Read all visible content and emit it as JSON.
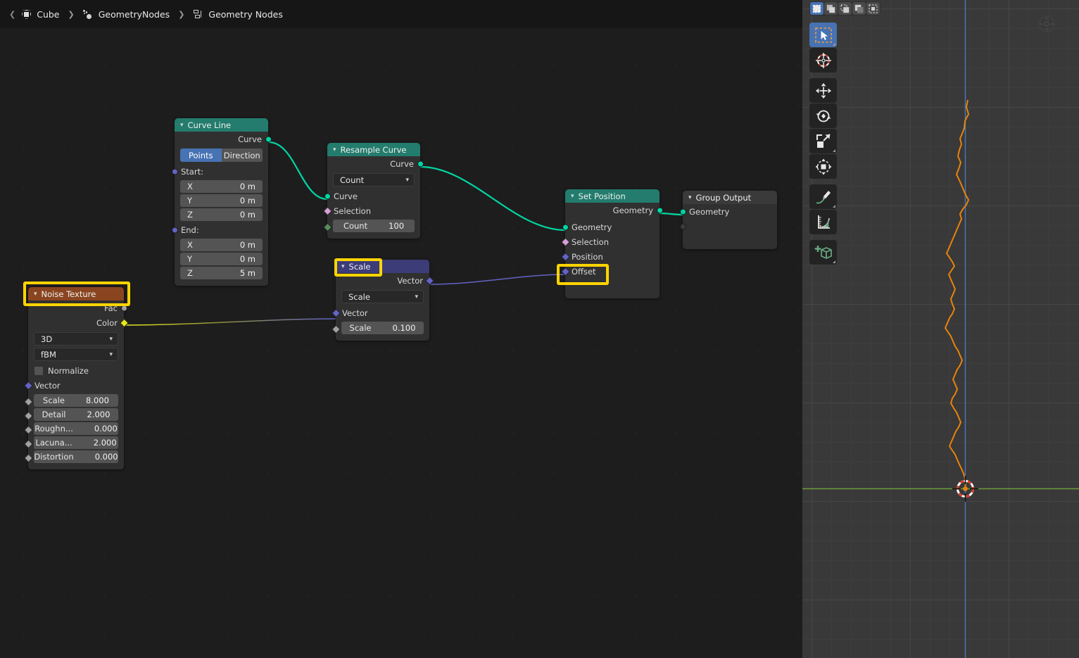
{
  "breadcrumb": {
    "back_arrow": "❮",
    "items": [
      {
        "label": "Cube",
        "icon": "object-icon"
      },
      {
        "label": "GeometryNodes",
        "icon": "modifier-icon"
      },
      {
        "label": "Geometry Nodes",
        "icon": "node-tree-icon"
      }
    ],
    "separator": "❯"
  },
  "nodes": {
    "curve_line": {
      "title": "Curve Line",
      "header_color": "#237c6d",
      "outputs": [
        {
          "label": "Curve",
          "type": "geometry"
        }
      ],
      "mode_toggle": {
        "option_a": "Points",
        "option_b": "Direction",
        "selected": "Points"
      },
      "start_label": "Start:",
      "start": [
        {
          "axis": "X",
          "value": "0 m"
        },
        {
          "axis": "Y",
          "value": "0 m"
        },
        {
          "axis": "Z",
          "value": "0 m"
        }
      ],
      "end_label": "End:",
      "end": [
        {
          "axis": "X",
          "value": "0 m"
        },
        {
          "axis": "Y",
          "value": "0 m"
        },
        {
          "axis": "Z",
          "value": "5 m"
        }
      ]
    },
    "resample_curve": {
      "title": "Resample Curve",
      "header_color": "#237c6d",
      "outputs": [
        {
          "label": "Curve",
          "type": "geometry"
        }
      ],
      "mode": "Count",
      "inputs": [
        {
          "label": "Curve",
          "type": "geometry"
        },
        {
          "label": "Selection",
          "type": "boolean"
        }
      ],
      "count": {
        "label": "Count",
        "value": "100"
      }
    },
    "set_position": {
      "title": "Set Position",
      "header_color": "#237c6d",
      "outputs": [
        {
          "label": "Geometry",
          "type": "geometry"
        }
      ],
      "inputs": [
        {
          "label": "Geometry",
          "type": "geometry"
        },
        {
          "label": "Selection",
          "type": "boolean"
        },
        {
          "label": "Position",
          "type": "vector"
        },
        {
          "label": "Offset",
          "type": "vector",
          "highlighted": true
        }
      ]
    },
    "group_output": {
      "title": "Group Output",
      "header_color": "#3a3a3a",
      "inputs": [
        {
          "label": "Geometry",
          "type": "geometry"
        }
      ]
    },
    "scale": {
      "title": "Scale",
      "header_color": "#3c3c78",
      "highlighted": true,
      "outputs": [
        {
          "label": "Vector",
          "type": "vector"
        }
      ],
      "operation": "Scale",
      "inputs": [
        {
          "label": "Vector",
          "type": "vector"
        }
      ],
      "scale_field": {
        "label": "Scale",
        "value": "0.100"
      }
    },
    "noise_texture": {
      "title": "Noise Texture",
      "header_color": "#8a4520",
      "highlighted": true,
      "outputs": [
        {
          "label": "Fac",
          "type": "float"
        },
        {
          "label": "Color",
          "type": "color"
        }
      ],
      "dimension": "3D",
      "noise_type": "fBM",
      "normalize": {
        "label": "Normalize",
        "checked": false
      },
      "vector_input": "Vector",
      "fields": [
        {
          "label": "Scale",
          "value": "8.000"
        },
        {
          "label": "Detail",
          "value": "2.000"
        },
        {
          "label": "Roughn...",
          "value": "0.000"
        },
        {
          "label": "Lacuna...",
          "value": "2.000"
        },
        {
          "label": "Distortion",
          "value": "0.000"
        }
      ]
    }
  },
  "viewport": {
    "select_modes": [
      {
        "name": "set-selection",
        "active": true
      },
      {
        "name": "extend-selection",
        "active": false
      },
      {
        "name": "subtract-selection",
        "active": false
      },
      {
        "name": "invert-selection",
        "active": false
      },
      {
        "name": "intersect-selection",
        "active": false
      }
    ],
    "tools": [
      {
        "name": "tweak-tool",
        "icon": "cursor-arrow-icon",
        "active": true
      },
      {
        "name": "cursor-tool",
        "icon": "crosshair-icon",
        "active": false
      },
      {
        "name": "move-tool",
        "icon": "move-arrows-icon",
        "active": false
      },
      {
        "name": "rotate-tool",
        "icon": "rotate-icon",
        "active": false
      },
      {
        "name": "scale-tool",
        "icon": "scale-icon",
        "active": false
      },
      {
        "name": "transform-tool",
        "icon": "transform-icon",
        "active": false
      },
      {
        "name": "annotate-tool",
        "icon": "pencil-icon",
        "active": false
      },
      {
        "name": "measure-tool",
        "icon": "ruler-icon",
        "active": false
      },
      {
        "name": "add-cube-tool",
        "icon": "add-cube-icon",
        "active": false
      }
    ],
    "axis_colors": {
      "z_axis": "#4772b3",
      "y_axis": "#6e9e3a",
      "curve": "#e8830c"
    }
  }
}
